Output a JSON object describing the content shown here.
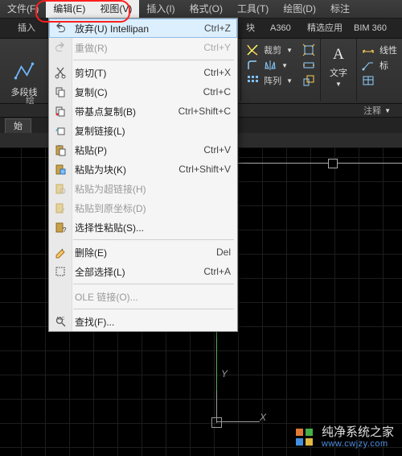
{
  "menubar": {
    "items": [
      {
        "label": "文件(F)"
      },
      {
        "label": "编辑(E)"
      },
      {
        "label": "视图(V)"
      },
      {
        "label": "插入(I)"
      },
      {
        "label": "格式(O)"
      },
      {
        "label": "工具(T)"
      },
      {
        "label": "绘图(D)"
      },
      {
        "label": "标注"
      }
    ]
  },
  "contextTabs": {
    "insert": "插入",
    "blocks": "块",
    "a360": "A360",
    "apps": "精选应用",
    "bim": "BIM 360"
  },
  "ribbon": {
    "polyline": "多段线",
    "groupDraw": "绘",
    "text": "文字",
    "layer": "线性",
    "layerMark": "标",
    "dim1": "裁剪",
    "dim2": "阵列",
    "panelAnno": "注释"
  },
  "sub": {
    "start": "始"
  },
  "dropdown": {
    "items": [
      {
        "icon": "undo-icon",
        "label": "放弃(U) Intellipan",
        "shortcut": "Ctrl+Z",
        "hi": true
      },
      {
        "icon": "redo-icon",
        "label": "重做(R)",
        "shortcut": "Ctrl+Y",
        "disabled": true
      },
      {
        "sep": true
      },
      {
        "icon": "cut-icon",
        "label": "剪切(T)",
        "shortcut": "Ctrl+X"
      },
      {
        "icon": "copy-icon",
        "label": "复制(C)",
        "shortcut": "Ctrl+C"
      },
      {
        "icon": "copy-base-icon",
        "label": "带基点复制(B)",
        "shortcut": "Ctrl+Shift+C"
      },
      {
        "icon": "copy-link-icon",
        "label": "复制链接(L)",
        "shortcut": ""
      },
      {
        "icon": "paste-icon",
        "label": "粘贴(P)",
        "shortcut": "Ctrl+V"
      },
      {
        "icon": "paste-block-icon",
        "label": "粘贴为块(K)",
        "shortcut": "Ctrl+Shift+V"
      },
      {
        "icon": "paste-hyperlink-icon",
        "label": "粘贴为超链接(H)",
        "shortcut": "",
        "disabled": true
      },
      {
        "icon": "paste-orig-icon",
        "label": "粘贴到原坐标(D)",
        "shortcut": "",
        "disabled": true
      },
      {
        "icon": "paste-special-icon",
        "label": "选择性粘贴(S)...",
        "shortcut": ""
      },
      {
        "sep": true
      },
      {
        "icon": "erase-icon",
        "label": "删除(E)",
        "shortcut": "Del"
      },
      {
        "icon": "select-all-icon",
        "label": "全部选择(L)",
        "shortcut": "Ctrl+A"
      },
      {
        "sep": true
      },
      {
        "icon": "",
        "label": "OLE 链接(O)...",
        "shortcut": "",
        "disabled": true
      },
      {
        "sep": true
      },
      {
        "icon": "find-icon",
        "label": "查找(F)...",
        "shortcut": ""
      }
    ]
  },
  "canvas": {
    "axisY": "Y",
    "axisX": "X"
  },
  "watermark": {
    "line1": "纯净系统之家",
    "line2": "www.cwjzy.com"
  }
}
